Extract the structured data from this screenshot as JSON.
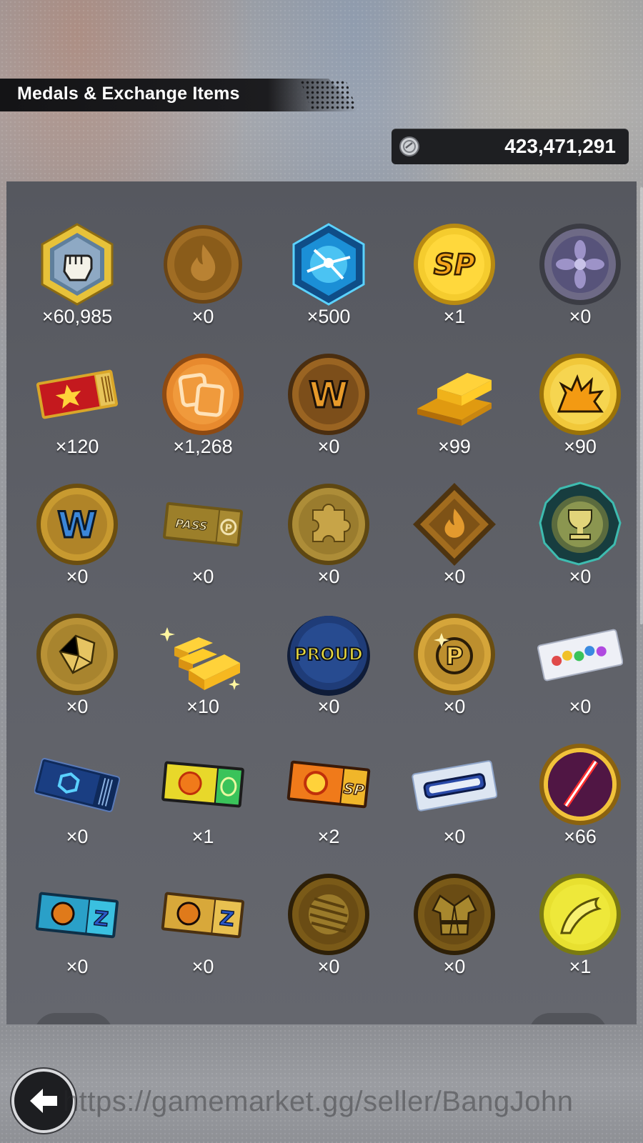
{
  "header": {
    "title": "Medals & Exchange Items"
  },
  "currency": {
    "icon": "silver-coin-icon",
    "value": "423,471,291"
  },
  "items": [
    {
      "icon": "fist-hexagon-medal-icon",
      "count": "×60,985"
    },
    {
      "icon": "flame-bronze-coin-icon",
      "count": "×0"
    },
    {
      "icon": "blue-energy-hexagon-icon",
      "count": "×500"
    },
    {
      "icon": "sp-gold-coin-icon",
      "count": "×1"
    },
    {
      "icon": "purple-flower-coin-icon",
      "count": "×0"
    },
    {
      "icon": "red-star-ticket-icon",
      "count": "×120"
    },
    {
      "icon": "card-orange-coin-icon",
      "count": "×1,268"
    },
    {
      "icon": "w-bronze-coin-icon",
      "count": "×0"
    },
    {
      "icon": "gold-bars-icon",
      "count": "×99"
    },
    {
      "icon": "explosion-gold-coin-icon",
      "count": "×90"
    },
    {
      "icon": "w-blue-gold-coin-icon",
      "count": "×0"
    },
    {
      "icon": "premium-pass-ticket-icon",
      "count": "×0"
    },
    {
      "icon": "puzzle-gold-coin-icon",
      "count": "×0"
    },
    {
      "icon": "flame-diamond-medal-icon",
      "count": "×0"
    },
    {
      "icon": "trophy-teal-badge-icon",
      "count": "×0"
    },
    {
      "icon": "crystal-gold-coin-icon",
      "count": "×0"
    },
    {
      "icon": "sparkling-gold-bars-icon",
      "count": "×10"
    },
    {
      "icon": "proud-blue-coin-icon",
      "count": "×0"
    },
    {
      "icon": "p-gold-coin-icon",
      "count": "×0"
    },
    {
      "icon": "gem-ticket-icon",
      "count": "×0"
    },
    {
      "icon": "blue-hexagon-ticket-icon",
      "count": "×0"
    },
    {
      "icon": "green-flame-ticket-icon",
      "count": "×1"
    },
    {
      "icon": "sp-flame-ticket-icon",
      "count": "×2"
    },
    {
      "icon": "blue-bar-ticket-icon",
      "count": "×0"
    },
    {
      "icon": "red-saber-coin-icon",
      "count": "×66"
    },
    {
      "icon": "blue-z-ticket-icon",
      "count": "×0"
    },
    {
      "icon": "gold-z-ticket-icon",
      "count": "×0"
    },
    {
      "icon": "bandage-bronze-coin-icon",
      "count": "×0"
    },
    {
      "icon": "gi-bronze-coin-icon",
      "count": "×0"
    },
    {
      "icon": "yellow-leaf-coin-icon",
      "count": "×1"
    }
  ],
  "footer": {
    "back_icon": "back-arrow-icon",
    "watermark": "https://gamemarket.gg/seller/BangJohn"
  }
}
